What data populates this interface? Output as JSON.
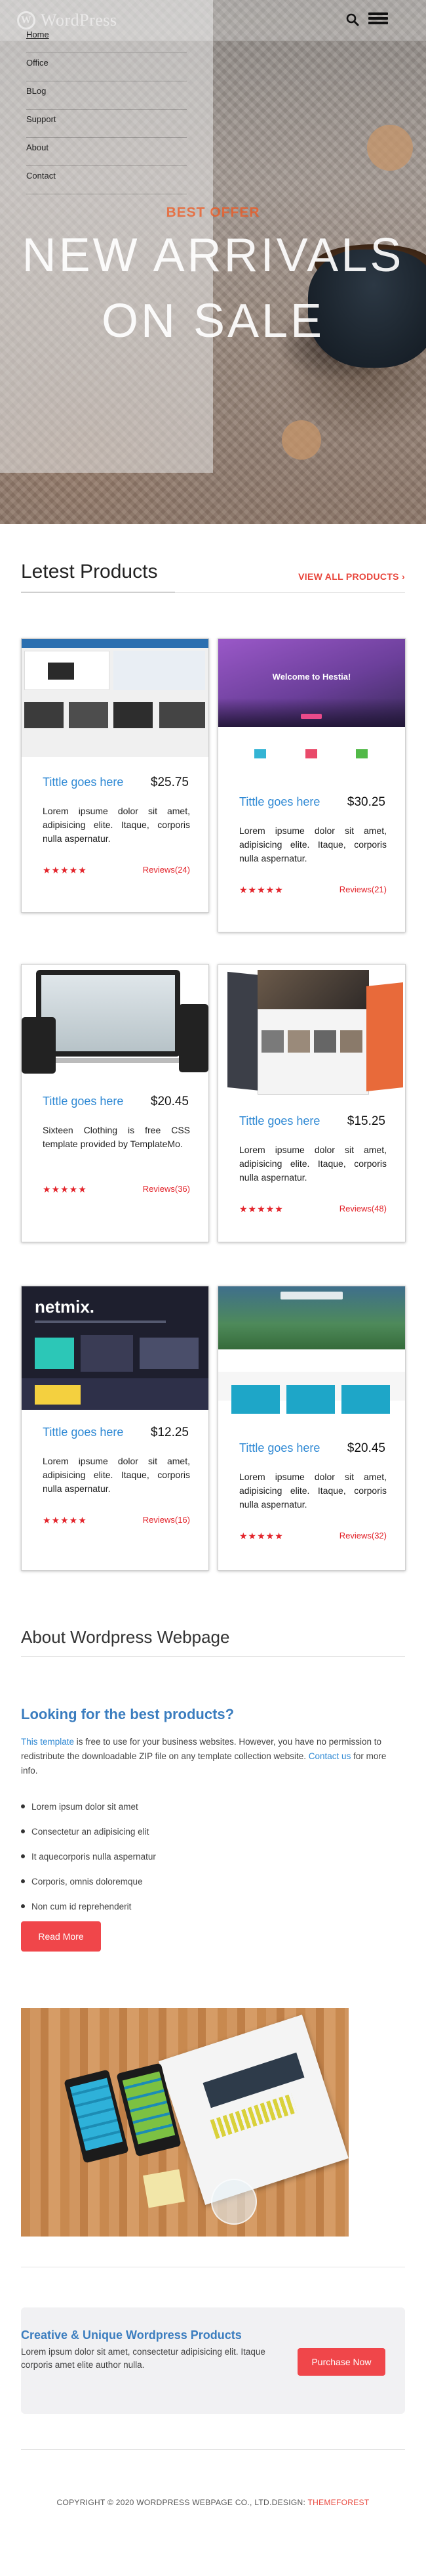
{
  "header": {
    "logo_text": "WordPress",
    "nav": [
      {
        "label": "Home",
        "active": true
      },
      {
        "label": "Office"
      },
      {
        "label": "BLog"
      },
      {
        "label": "Support"
      },
      {
        "label": "About"
      },
      {
        "label": "Contact"
      }
    ],
    "icons": [
      "search-icon",
      "hamburger-menu-icon"
    ]
  },
  "hero": {
    "offer": "BEST OFFER",
    "line1": "NEW ARRIVALS",
    "line2": "ON SALE"
  },
  "products": {
    "title": "Letest Products",
    "view_all": "VIEW ALL PRODUCTS",
    "items": [
      {
        "title": "Tittle goes here",
        "price": "$25.75",
        "desc": "Lorem ipsume dolor sit amet, adipisicing elite. Itaque, corporis nulla aspernatur.",
        "stars": "★★★★★",
        "reviews": "Reviews(24)"
      },
      {
        "title": "Tittle goes here",
        "price": "$30.25",
        "desc": "Lorem ipsume dolor sit amet, adipisicing elite. Itaque, corporis nulla aspernatur.",
        "stars": "★★★★★",
        "reviews": "Reviews(21)",
        "thumb_text": "Welcome to Hestia!"
      },
      {
        "title": "Tittle goes here",
        "price": "$20.45",
        "desc": "Sixteen Clothing is free CSS template provided by TemplateMo.",
        "stars": "★★★★★",
        "reviews": "Reviews(36)"
      },
      {
        "title": "Tittle goes here",
        "price": "$15.25",
        "desc": "Lorem ipsume dolor sit amet, adipisicing elite. Itaque, corporis nulla aspernatur.",
        "stars": "★★★★★",
        "reviews": "Reviews(48)"
      },
      {
        "title": "Tittle goes here",
        "price": "$12.25",
        "desc": "Lorem ipsume dolor sit amet, adipisicing elite. Itaque, corporis nulla aspernatur.",
        "stars": "★★★★★",
        "reviews": "Reviews(16)",
        "thumb_text": "netmix."
      },
      {
        "title": "Tittle goes here",
        "price": "$20.45",
        "desc": "Lorem ipsume dolor sit amet, adipisicing elite. Itaque, corporis nulla aspernatur.",
        "stars": "★★★★★",
        "reviews": "Reviews(32)"
      }
    ]
  },
  "about": {
    "title": "About Wordpress Webpage",
    "question": "Looking for the best products?",
    "link_text": "This template",
    "text": " is free to use for your business websites. However, you have no permission to redistribute the downloadable ZIP file on any template collection website.",
    "contact_link": "Contact us",
    "contact_tail": " for more info.",
    "bullets": [
      "Lorem ipsum dolor sit amet",
      "Consectetur an adipisicing elit",
      "It aquecorporis nulla aspernatur",
      "Corporis, omnis doloremque",
      "Non cum id reprehenderit"
    ],
    "read_more": "Read More"
  },
  "cta": {
    "title": "Creative & Unique Wordpress Products",
    "text": "Lorem ipsum dolor sit amet, consectetur adipisicing elit. Itaque corporis amet elite author nulla.",
    "button": "Purchase Now"
  },
  "footer": {
    "copyright": "COPYRIGHT © 2020 WORDPRESS WEBPAGE CO., LTD.DESIGN: ",
    "link": "THEMEFOREST"
  },
  "colors": {
    "accent": "#f0464a",
    "link": "#2f89d4",
    "offer": "#f0581f",
    "heading_blue": "#3b7dbf"
  }
}
